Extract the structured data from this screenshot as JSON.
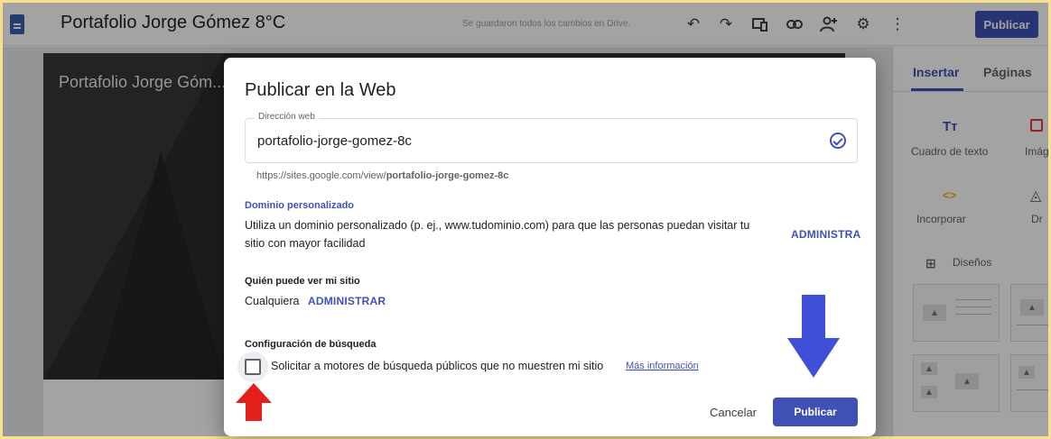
{
  "colors": {
    "accent": "#3f51b5",
    "frame": "#f9e08f",
    "arrow_red": "#e3201b",
    "arrow_blue": "#3f4fd8"
  },
  "topbar": {
    "title": "Portafolio Jorge Gómez 8°C",
    "save_status": "Se guardaron todos los cambios en Drive.",
    "icons": [
      "undo-icon",
      "redo-icon",
      "preview-icon",
      "link-icon",
      "share-icon",
      "settings-icon",
      "more-vert-icon"
    ],
    "publish_label": "Publicar"
  },
  "canvas": {
    "hero_title": "Portafolio Jorge Góm..."
  },
  "panel": {
    "tabs": [
      "Insertar",
      "Páginas"
    ],
    "items": [
      {
        "icon": "Tт",
        "label": "Cuadro de texto"
      },
      {
        "icon": "",
        "label": "Imág"
      },
      {
        "icon": "<>",
        "label": "Incorporar"
      },
      {
        "icon": "",
        "label": "Dr"
      }
    ],
    "layouts_label": "Diseños"
  },
  "dialog": {
    "title": "Publicar en la Web",
    "web_address_label": "Dirección web",
    "web_address_value": "portafolio-jorge-gomez-8c",
    "full_url_prefix": "https://sites.google.com/view/",
    "full_url_slug": "portafolio-jorge-gomez-8c",
    "custom_domain_title": "Dominio personalizado",
    "custom_domain_text_line1": "Utiliza un dominio personalizado (p. ej., www.tudominio.com) para que las personas puedan visitar tu",
    "custom_domain_text_line2": "sitio con mayor facilidad",
    "custom_domain_action": "ADMINISTRA",
    "who_can_see_title": "Quién puede ver mi sitio",
    "who_can_see_value": "Cualquiera",
    "who_can_see_action": "ADMINISTRAR",
    "search_config_title": "Configuración de búsqueda",
    "search_checkbox_label": "Solicitar a motores de búsqueda públicos que no muestren mi sitio",
    "search_checkbox_checked": false,
    "more_info_link": "Más información",
    "cancel_label": "Cancelar",
    "publish_label": "Publicar"
  }
}
